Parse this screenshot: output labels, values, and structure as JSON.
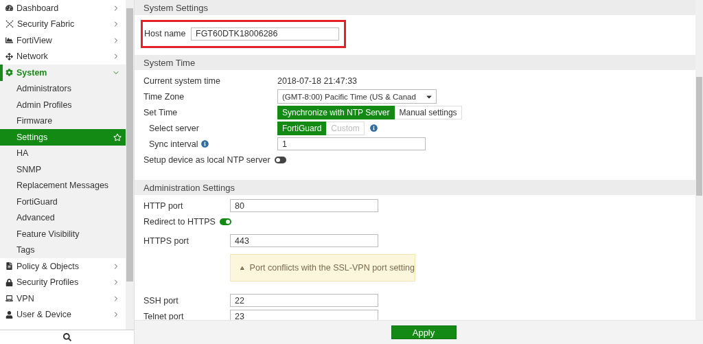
{
  "sidebar": {
    "items": [
      {
        "label": "Dashboard",
        "expanded": false
      },
      {
        "label": "Security Fabric",
        "expanded": false
      },
      {
        "label": "FortiView",
        "expanded": false
      },
      {
        "label": "Network",
        "expanded": false
      },
      {
        "label": "System",
        "expanded": true,
        "children": [
          {
            "label": "Administrators",
            "selected": false
          },
          {
            "label": "Admin Profiles",
            "selected": false
          },
          {
            "label": "Firmware",
            "selected": false
          },
          {
            "label": "Settings",
            "selected": true
          },
          {
            "label": "HA",
            "selected": false
          },
          {
            "label": "SNMP",
            "selected": false
          },
          {
            "label": "Replacement Messages",
            "selected": false
          },
          {
            "label": "FortiGuard",
            "selected": false
          },
          {
            "label": "Advanced",
            "selected": false
          },
          {
            "label": "Feature Visibility",
            "selected": false
          },
          {
            "label": "Tags",
            "selected": false
          }
        ]
      },
      {
        "label": "Policy & Objects",
        "expanded": false
      },
      {
        "label": "Security Profiles",
        "expanded": false
      },
      {
        "label": "VPN",
        "expanded": false
      },
      {
        "label": "User & Device",
        "expanded": false
      }
    ]
  },
  "sections": [
    {
      "title": "System Settings",
      "rows": [
        {
          "kind": "input",
          "label": "Host name",
          "value": "FGT60DTK18006286",
          "highlighted": true
        }
      ]
    },
    {
      "title": "System Time",
      "rows": [
        {
          "kind": "text",
          "label": "Current system time",
          "value": "2018-07-18 21:47:33"
        },
        {
          "kind": "select",
          "label": "Time Zone",
          "value": "(GMT-8:00) Pacific Time (US & Canad"
        },
        {
          "kind": "segmented",
          "label": "Set Time",
          "options": [
            {
              "label": "Synchronize with NTP Server",
              "selected": true,
              "disabled": false
            },
            {
              "label": "Manual settings",
              "selected": false,
              "disabled": false
            }
          ],
          "children": [
            {
              "kind": "segmented",
              "label": "Select server",
              "info": true,
              "options": [
                {
                  "label": "FortiGuard",
                  "selected": true,
                  "disabled": false
                },
                {
                  "label": "Custom",
                  "selected": false,
                  "disabled": true
                }
              ]
            },
            {
              "kind": "input",
              "label": "Sync interval",
              "label_info": true,
              "value": "1"
            }
          ]
        },
        {
          "kind": "toggle",
          "label": "Setup device as local NTP server",
          "on": false
        }
      ]
    },
    {
      "title": "Administration Settings",
      "rows": [
        {
          "kind": "input",
          "label": "HTTP port",
          "value": "80"
        },
        {
          "kind": "toggle",
          "label": "Redirect to HTTPS",
          "on": true
        },
        {
          "kind": "input",
          "label": "HTTPS port",
          "value": "443"
        },
        {
          "kind": "warning",
          "text": "Port conflicts with the SSL-VPN port setting"
        },
        {
          "kind": "input",
          "label": "SSH port",
          "value": "22"
        },
        {
          "kind": "input",
          "label": "Telnet port",
          "value": "23"
        }
      ]
    }
  ],
  "footer": {
    "button": "Apply"
  }
}
